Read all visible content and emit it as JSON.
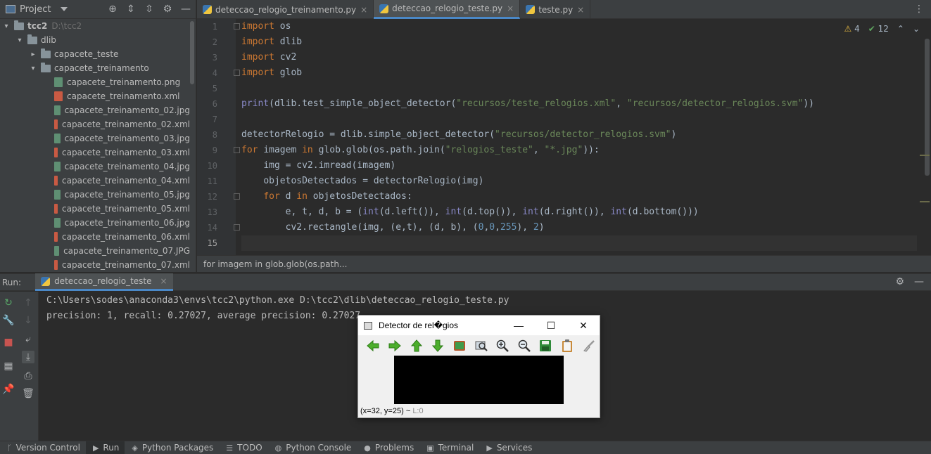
{
  "project": {
    "title": "Project",
    "tree": [
      {
        "label": "tcc2",
        "path": "D:\\tcc2",
        "depth": 0,
        "kind": "folder",
        "expanded": true
      },
      {
        "label": "dlib",
        "depth": 1,
        "kind": "folder",
        "expanded": true
      },
      {
        "label": "capacete_teste",
        "depth": 2,
        "kind": "folder",
        "expanded": false
      },
      {
        "label": "capacete_treinamento",
        "depth": 2,
        "kind": "folder",
        "expanded": true
      },
      {
        "label": "capacete_treinamento.png",
        "depth": 3,
        "kind": "img"
      },
      {
        "label": "capacete_treinamento.xml",
        "depth": 3,
        "kind": "xml"
      },
      {
        "label": "capacete_treinamento_02.jpg",
        "depth": 3,
        "kind": "img"
      },
      {
        "label": "capacete_treinamento_02.xml",
        "depth": 3,
        "kind": "xml"
      },
      {
        "label": "capacete_treinamento_03.jpg",
        "depth": 3,
        "kind": "img"
      },
      {
        "label": "capacete_treinamento_03.xml",
        "depth": 3,
        "kind": "xml"
      },
      {
        "label": "capacete_treinamento_04.jpg",
        "depth": 3,
        "kind": "img"
      },
      {
        "label": "capacete_treinamento_04.xml",
        "depth": 3,
        "kind": "xml"
      },
      {
        "label": "capacete_treinamento_05.jpg",
        "depth": 3,
        "kind": "img"
      },
      {
        "label": "capacete_treinamento_05.xml",
        "depth": 3,
        "kind": "xml"
      },
      {
        "label": "capacete_treinamento_06.jpg",
        "depth": 3,
        "kind": "img"
      },
      {
        "label": "capacete_treinamento_06.xml",
        "depth": 3,
        "kind": "xml"
      },
      {
        "label": "capacete_treinamento_07.JPG",
        "depth": 3,
        "kind": "img"
      },
      {
        "label": "capacete_treinamento_07.xml",
        "depth": 3,
        "kind": "xml"
      }
    ]
  },
  "editor": {
    "tabs": [
      {
        "label": "deteccao_relogio_treinamento.py",
        "active": false
      },
      {
        "label": "deteccao_relogio_teste.py",
        "active": true
      },
      {
        "label": "teste.py",
        "active": false
      }
    ],
    "warnings": "4",
    "checks": "12",
    "line_numbers": [
      "1",
      "2",
      "3",
      "4",
      "5",
      "6",
      "7",
      "8",
      "9",
      "10",
      "11",
      "12",
      "13",
      "14",
      "15"
    ],
    "code": [
      "import os",
      "import dlib",
      "import cv2",
      "import glob",
      "",
      "print(dlib.test_simple_object_detector(\"recursos/teste_relogios.xml\", \"recursos/detector_relogios.svm\"))",
      "",
      "detectorRelogio = dlib.simple_object_detector(\"recursos/detector_relogios.svm\")",
      "for imagem in glob.glob(os.path.join(\"relogios_teste\", \"*.jpg\")):",
      "    img = cv2.imread(imagem)",
      "    objetosDetectados = detectorRelogio(img)",
      "    for d in objetosDetectados:",
      "        e, t, d, b = (int(d.left()), int(d.top()), int(d.right()), int(d.bottom()))",
      "        cv2.rectangle(img, (e,t), (d, b), (0,0,255), 2)",
      ""
    ],
    "breadcrumb": "for imagem in glob.glob(os.path..."
  },
  "run": {
    "label": "Run:",
    "tab": "deteccao_relogio_teste",
    "output": [
      "C:\\Users\\sodes\\anaconda3\\envs\\tcc2\\python.exe D:\\tcc2\\dlib\\deteccao_relogio_teste.py",
      "precision: 1, recall: 0.27027, average precision: 0.27027"
    ]
  },
  "bottom_bar": [
    {
      "label": "Version Control",
      "icon": "branch-icon"
    },
    {
      "label": "Run",
      "icon": "play-icon"
    },
    {
      "label": "Python Packages",
      "icon": "packages-icon"
    },
    {
      "label": "TODO",
      "icon": "list-icon"
    },
    {
      "label": "Python Console",
      "icon": "python-icon"
    },
    {
      "label": "Problems",
      "icon": "alert-icon"
    },
    {
      "label": "Terminal",
      "icon": "terminal-icon"
    },
    {
      "label": "Services",
      "icon": "services-icon"
    }
  ],
  "detector_window": {
    "title": "Detector de rel�gios",
    "status": "(x=32, y=25) ~",
    "level": "L:0"
  },
  "colors": {
    "accent": "#4a88c7",
    "keyword": "#cc7832",
    "string": "#6a8759",
    "number": "#6897bb",
    "builtin": "#8888c6"
  }
}
